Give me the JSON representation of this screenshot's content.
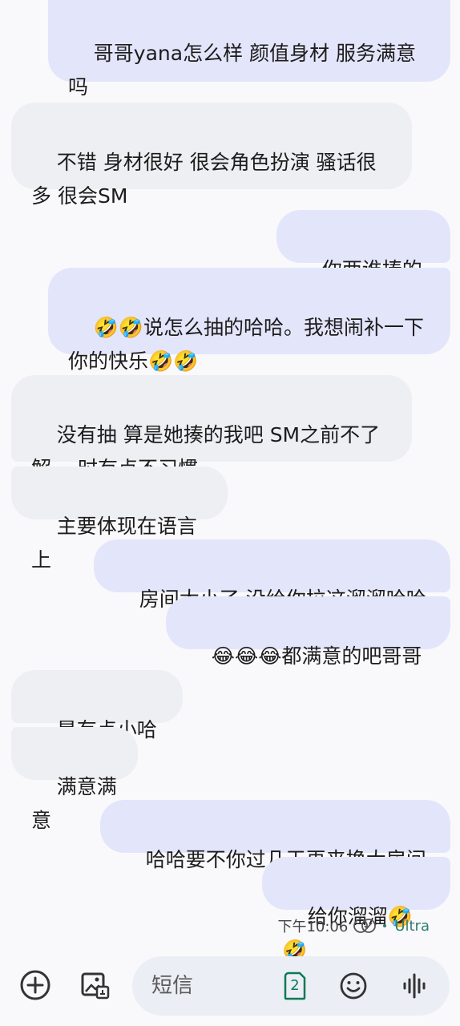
{
  "messages": [
    {
      "dir": "out",
      "text": "哥哥yana怎么样 颜值身材 服务满意吗"
    },
    {
      "dir": "in",
      "text": "不错 身材很好 很会角色扮演 骚话很多 很会SM"
    },
    {
      "dir": "out",
      "text": "你两谁揍的谁"
    },
    {
      "dir": "out",
      "text": "🤣🤣说怎么抽的哈哈。我想闹补一下你的快乐🤣🤣"
    },
    {
      "dir": "in",
      "text": "没有抽 算是她揍的我吧 SM之前不了解 一时有点不习惯"
    },
    {
      "dir": "in",
      "text": "主要体现在语言上"
    },
    {
      "dir": "out",
      "text": "房间太小了 没给你拉这溜溜哈哈"
    },
    {
      "dir": "out",
      "text": "😂😂😂都满意的吧哥哥"
    },
    {
      "dir": "in",
      "text": "是有点小哈哈"
    },
    {
      "dir": "in",
      "text": "满意满意"
    },
    {
      "dir": "out",
      "text": "哈哈要不你过几天再来换大房间"
    },
    {
      "dir": "out",
      "text": "给你溜溜🤣🤣"
    }
  ],
  "status": {
    "time": "下午10:06",
    "network": "Ultra"
  },
  "composer": {
    "placeholder": "短信",
    "sim_badge": "2"
  },
  "colors": {
    "outgoing_bubble": "#e3e5fb",
    "incoming_bubble": "#eeeff3",
    "background": "#f9f9fc",
    "network_accent": "#2e7d6d"
  },
  "icons": {
    "add": "plus-circle-icon",
    "gallery": "image-icon",
    "sim": "sim-card-icon",
    "emoji": "smiley-icon",
    "voice": "waveform-icon"
  }
}
